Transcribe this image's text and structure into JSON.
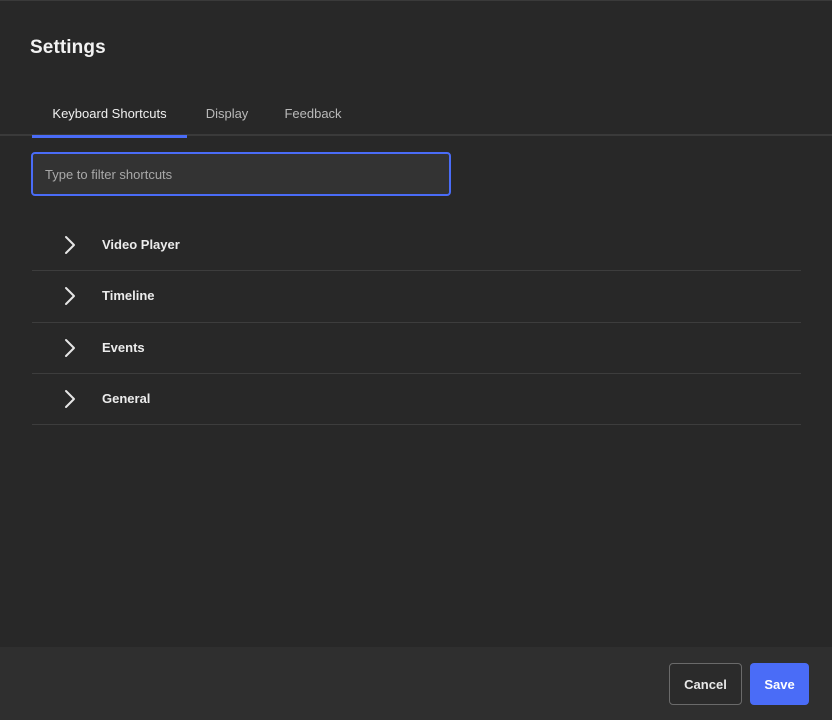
{
  "dialog": {
    "title": "Settings"
  },
  "tabs": [
    {
      "label": "Keyboard Shortcuts",
      "active": true
    },
    {
      "label": "Display",
      "active": false
    },
    {
      "label": "Feedback",
      "active": false
    }
  ],
  "filter": {
    "placeholder": "Type to filter shortcuts",
    "value": ""
  },
  "groups": [
    {
      "label": "Video Player",
      "icon": "chevron-right-icon"
    },
    {
      "label": "Timeline",
      "icon": "chevron-right-icon"
    },
    {
      "label": "Events",
      "icon": "chevron-right-icon"
    },
    {
      "label": "General",
      "icon": "chevron-right-icon"
    }
  ],
  "footer": {
    "cancel_label": "Cancel",
    "save_label": "Save"
  },
  "colors": {
    "accent": "#4a6cf7",
    "background": "#282828",
    "footer": "#2f2f2f"
  }
}
